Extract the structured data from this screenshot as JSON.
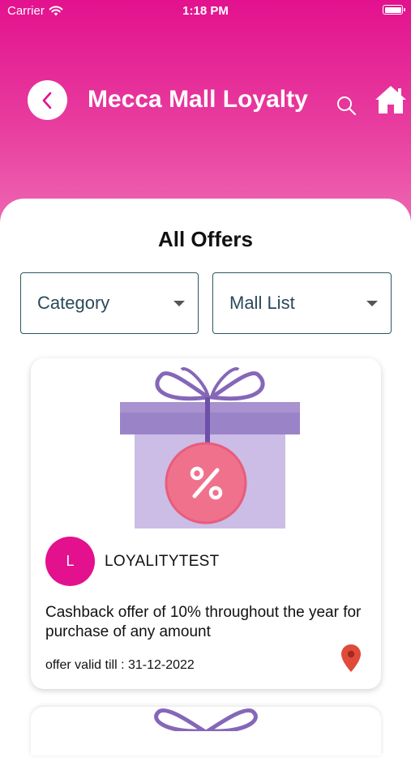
{
  "status_bar": {
    "carrier": "Carrier",
    "time": "1:18 PM",
    "battery_level": 1.0
  },
  "header": {
    "title": "Mecca Mall Loyalty"
  },
  "main": {
    "section_title": "All Offers",
    "filters": {
      "category_label": "Category",
      "mall_label": "Mall List"
    },
    "offers": [
      {
        "avatar_letter": "L",
        "merchant": "LOYALITYTEST",
        "description": "Cashback offer of 10% throughout the year for purchase of any amount",
        "validity": "offer valid till : 31-12-2022"
      }
    ]
  },
  "colors": {
    "brand": "#e3118e",
    "gift_ribbon": "#8567b8",
    "gift_box": "#cbbde6",
    "gift_lid": "#9b83c8",
    "tag": "#f0718c",
    "pin": "#e04a3b",
    "dropdown_border": "#2f5566"
  },
  "icons": {
    "back": "chevron-left-icon",
    "search": "search-icon",
    "home": "home-icon",
    "wifi": "wifi-icon",
    "battery": "battery-icon",
    "location": "location-pin-icon",
    "offer_image": "gift-box-percent-icon"
  }
}
